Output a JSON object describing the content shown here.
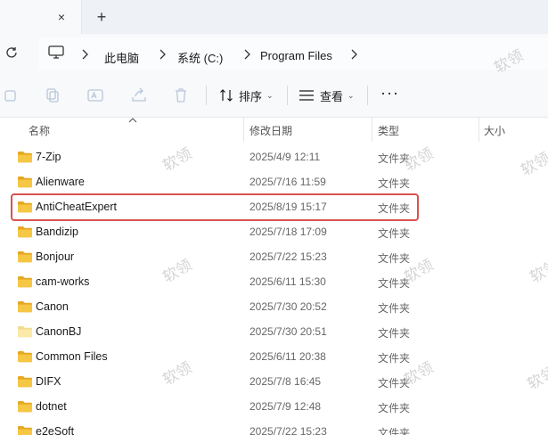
{
  "tabs": {
    "close_glyph": "×",
    "new_tab_glyph": "+"
  },
  "breadcrumb": [
    {
      "label": "此电脑"
    },
    {
      "label": "系统 (C:)"
    },
    {
      "label": "Program Files"
    }
  ],
  "command_bar": {
    "sort_label": "排序",
    "view_label": "查看",
    "more_glyph": "···"
  },
  "columns": {
    "name": "名称",
    "date": "修改日期",
    "type": "类型",
    "size": "大小"
  },
  "files": [
    {
      "name": "7-Zip",
      "date": "2025/4/9 12:11",
      "type": "文件夹"
    },
    {
      "name": "Alienware",
      "date": "2025/7/16 11:59",
      "type": "文件夹"
    },
    {
      "name": "AntiCheatExpert",
      "date": "2025/8/19 15:17",
      "type": "文件夹"
    },
    {
      "name": "Bandizip",
      "date": "2025/7/18 17:09",
      "type": "文件夹"
    },
    {
      "name": "Bonjour",
      "date": "2025/7/22 15:23",
      "type": "文件夹"
    },
    {
      "name": "cam-works",
      "date": "2025/6/11 15:30",
      "type": "文件夹"
    },
    {
      "name": "Canon",
      "date": "2025/7/30 20:52",
      "type": "文件夹"
    },
    {
      "name": "CanonBJ",
      "date": "2025/7/30 20:51",
      "type": "文件夹"
    },
    {
      "name": "Common Files",
      "date": "2025/6/11 20:38",
      "type": "文件夹"
    },
    {
      "name": "DIFX",
      "date": "2025/7/8 16:45",
      "type": "文件夹"
    },
    {
      "name": "dotnet",
      "date": "2025/7/9 12:48",
      "type": "文件夹"
    },
    {
      "name": "e2eSoft",
      "date": "2025/7/22 15:23",
      "type": "文件夹"
    }
  ],
  "highlighted_row": "AntiCheatExpert",
  "watermark_text": "软领",
  "colors": {
    "folder_fill": "#f6c744",
    "folder_back": "#e5a823",
    "highlight_border": "#d9534f",
    "selected_folder_fill": "#fbe9a8"
  }
}
